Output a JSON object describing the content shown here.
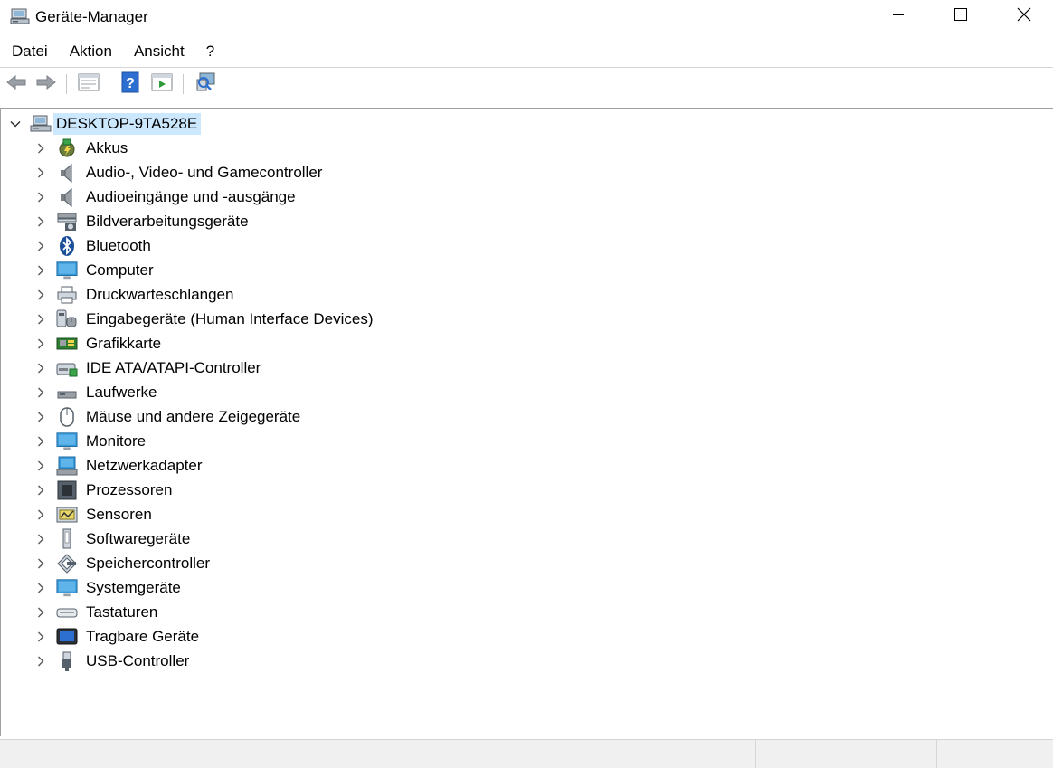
{
  "window": {
    "title": "Geräte-Manager",
    "icon": "device-manager-icon"
  },
  "window_controls": {
    "minimize": "minimize-icon",
    "maximize": "maximize-icon",
    "close": "close-icon"
  },
  "menu": [
    "Datei",
    "Aktion",
    "Ansicht",
    "?"
  ],
  "toolbar": [
    {
      "name": "back",
      "icon": "arrow-left-icon"
    },
    {
      "name": "forward",
      "icon": "arrow-right-icon"
    },
    {
      "name": "properties",
      "icon": "properties-icon"
    },
    {
      "name": "help",
      "icon": "help-icon"
    },
    {
      "name": "update-driver",
      "icon": "update-driver-icon"
    },
    {
      "name": "scan-hardware",
      "icon": "scan-hardware-icon"
    }
  ],
  "tree": {
    "root": {
      "label": "DESKTOP-9TA528E",
      "expanded": true,
      "selected": true,
      "icon": "computer-tower-icon"
    },
    "categories": [
      {
        "label": "Akkus",
        "icon": "battery-icon"
      },
      {
        "label": "Audio-, Video- und Gamecontroller",
        "icon": "speaker-icon"
      },
      {
        "label": "Audioeingänge und -ausgänge",
        "icon": "speaker-icon"
      },
      {
        "label": "Bildverarbeitungsgeräte",
        "icon": "camera-icon"
      },
      {
        "label": "Bluetooth",
        "icon": "bluetooth-icon"
      },
      {
        "label": "Computer",
        "icon": "monitor-icon"
      },
      {
        "label": "Druckwarteschlangen",
        "icon": "printer-icon"
      },
      {
        "label": "Eingabegeräte (Human Interface Devices)",
        "icon": "hid-icon"
      },
      {
        "label": "Grafikkarte",
        "icon": "graphics-card-icon"
      },
      {
        "label": "IDE ATA/ATAPI-Controller",
        "icon": "ide-controller-icon"
      },
      {
        "label": "Laufwerke",
        "icon": "drive-icon"
      },
      {
        "label": "Mäuse und andere Zeigegeräte",
        "icon": "mouse-icon"
      },
      {
        "label": "Monitore",
        "icon": "monitor-icon"
      },
      {
        "label": "Netzwerkadapter",
        "icon": "network-adapter-icon"
      },
      {
        "label": "Prozessoren",
        "icon": "processor-icon"
      },
      {
        "label": "Sensoren",
        "icon": "sensor-icon"
      },
      {
        "label": "Softwaregeräte",
        "icon": "software-device-icon"
      },
      {
        "label": "Speichercontroller",
        "icon": "storage-controller-icon"
      },
      {
        "label": "Systemgeräte",
        "icon": "system-device-icon"
      },
      {
        "label": "Tastaturen",
        "icon": "keyboard-icon"
      },
      {
        "label": "Tragbare Geräte",
        "icon": "portable-device-icon"
      },
      {
        "label": "USB-Controller",
        "icon": "usb-icon"
      }
    ]
  },
  "statusbar": {
    "panes": [
      "",
      "",
      ""
    ]
  },
  "colors": {
    "selection": "#cce8ff",
    "border": "#a0a0a0",
    "statusbar": "#f0f0f0"
  }
}
